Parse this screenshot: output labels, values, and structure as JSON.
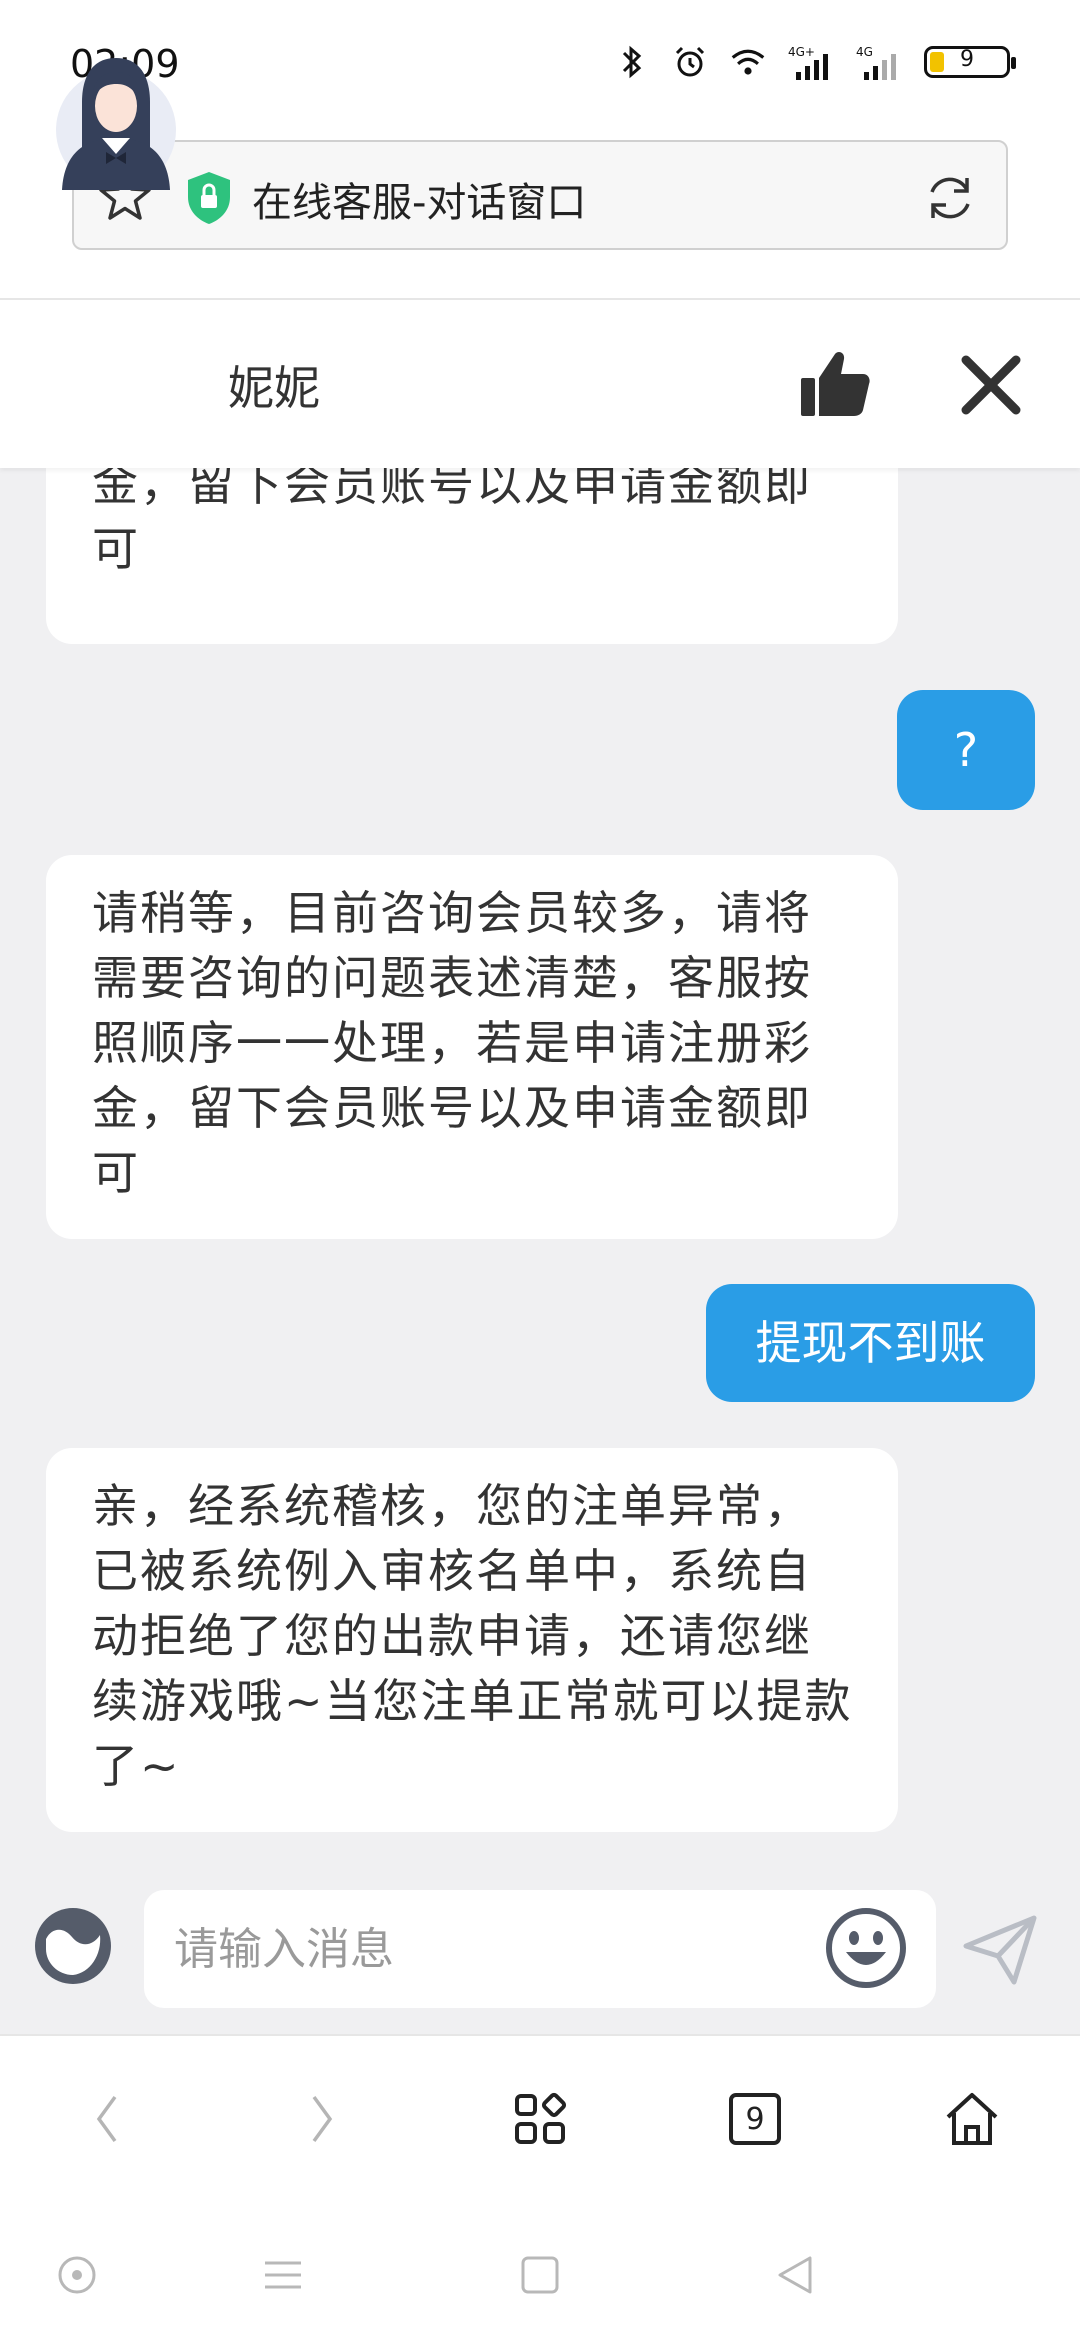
{
  "status_bar": {
    "time": "02:09",
    "battery_level": "9",
    "network_1": "4G+",
    "network_2": "4G"
  },
  "address_bar": {
    "title": "在线客服-对话窗口"
  },
  "chat_header": {
    "agent_name": "妮妮"
  },
  "messages": [
    {
      "from": "agent",
      "text": "…金，留下会员账号以及申请金额即可",
      "lines": [
        "金，留下会员账号以及申请金额即",
        "可"
      ]
    },
    {
      "from": "user",
      "text": "?"
    },
    {
      "from": "agent",
      "text": "请稍等，目前咨询会员较多，请将需要咨询的问题表述清楚，客服按照顺序一一处理，若是申请注册彩金，留下会员账号以及申请金额即可"
    },
    {
      "from": "user",
      "text": "提现不到账"
    },
    {
      "from": "agent",
      "text": "亲，经系统稽核，您的注单异常，已被系统例入审核名单中，系统自动拒绝了您的出款申请，还请您继续游戏哦~当您注单正常就可以提款了~"
    }
  ],
  "input": {
    "placeholder": "请输入消息",
    "value": ""
  },
  "browser_nav": {
    "tab_count": "9"
  },
  "colors": {
    "user_bubble": "#2a9de6",
    "chat_bg": "#f0f0f2",
    "shield": "#2ec27e"
  }
}
